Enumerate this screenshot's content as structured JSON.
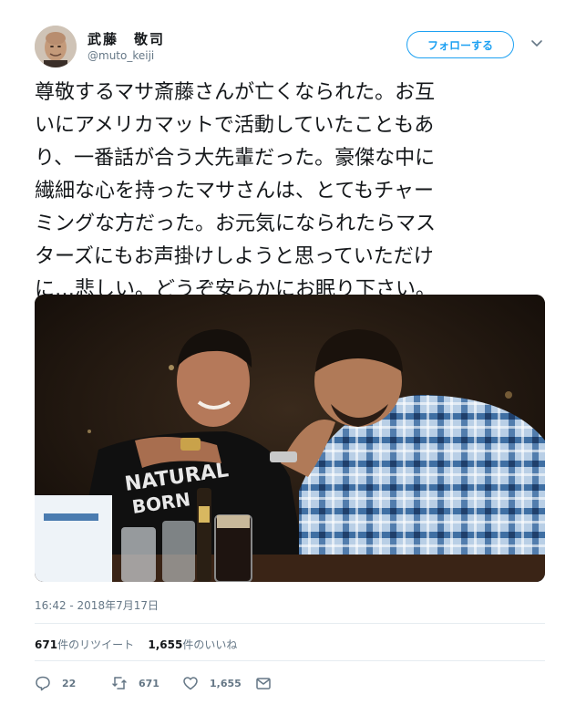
{
  "profile": {
    "name": "武藤　敬司",
    "handle": "@muto_keiji",
    "follow_label": "フォローする"
  },
  "tweet": {
    "text": "尊敬するマサ斎藤さんが亡くなられた。お互\nいにアメリカマットで活動していたこともあ\nり、一番話が合う大先輩だった。豪傑な中に\n繊細な心を持ったマサさんは、とてもチャー\nミングな方だった。お元気になられたらマス\nターズにもお声掛けしようと思っていただけ\nに…悲しい。どうぞ安らかにお眠り下さい。",
    "timestamp": "16:42 - 2018年7月17日"
  },
  "photo": {
    "shirt_text_1": "NATURAL",
    "shirt_text_2": "BORN"
  },
  "stats": {
    "retweets_count": "671",
    "retweets_label": "件のリツイート",
    "likes_count": "1,655",
    "likes_label": "件のいいね"
  },
  "actions": {
    "reply_count": "22",
    "retweet_count": "671",
    "like_count": "1,655"
  },
  "colors": {
    "accent": "#1da1f2",
    "secondary_text": "#657786",
    "divider": "#e6ecf0"
  },
  "icons": [
    "chevron-down-icon",
    "reply-icon",
    "retweet-icon",
    "like-icon",
    "direct-message-icon"
  ]
}
